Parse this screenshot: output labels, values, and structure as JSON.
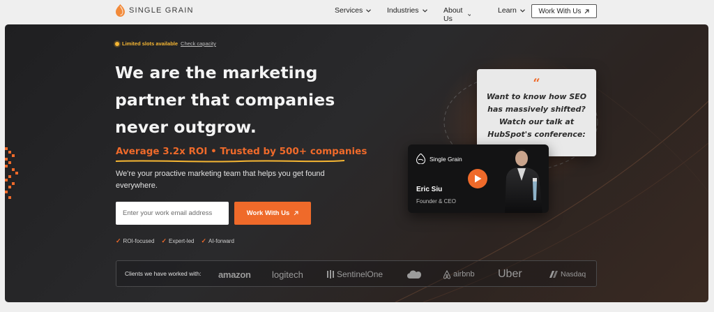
{
  "nav": {
    "brand": "SINGLE GRAIN",
    "items": [
      {
        "label": "Services"
      },
      {
        "label": "Industries"
      },
      {
        "label": "About Us"
      },
      {
        "label": "Learn"
      }
    ],
    "cta_label": "Work With Us"
  },
  "hero": {
    "badge_text": "Limited slots available",
    "badge_link": "Check capacity",
    "headline_line1": "We are the marketing",
    "headline_line2": "partner that companies",
    "headline_line3": "never outgrow.",
    "tagline": "Average 3.2x ROI • Trusted by 500+ companies",
    "subtext_line1": "We're your proactive marketing team that helps you get found",
    "subtext_line2": "everywhere.",
    "email_placeholder": "Enter your work email address",
    "cta_label": "Work With Us",
    "checks": [
      "ROI-focused",
      "Expert-led",
      "AI-forward"
    ]
  },
  "quote": {
    "mark": "“",
    "line1": "Want to know how SEO",
    "line2": "has massively shifted?",
    "line3": "Watch our talk at",
    "line4": "HubSpot's conference:"
  },
  "video": {
    "brand": "Single Grain",
    "name": "Eric Siu",
    "role": "Founder & CEO"
  },
  "clients": {
    "label": "Clients we have worked with:",
    "logos": [
      "amazon",
      "logitech",
      "SentinelOne",
      "salesforce",
      "airbnb",
      "Uber",
      "Nasdaq"
    ]
  },
  "colors": {
    "accent": "#ef6a2a",
    "badge": "#f7b733",
    "hero_bg": "#242426",
    "nav_bg": "#efefef"
  }
}
